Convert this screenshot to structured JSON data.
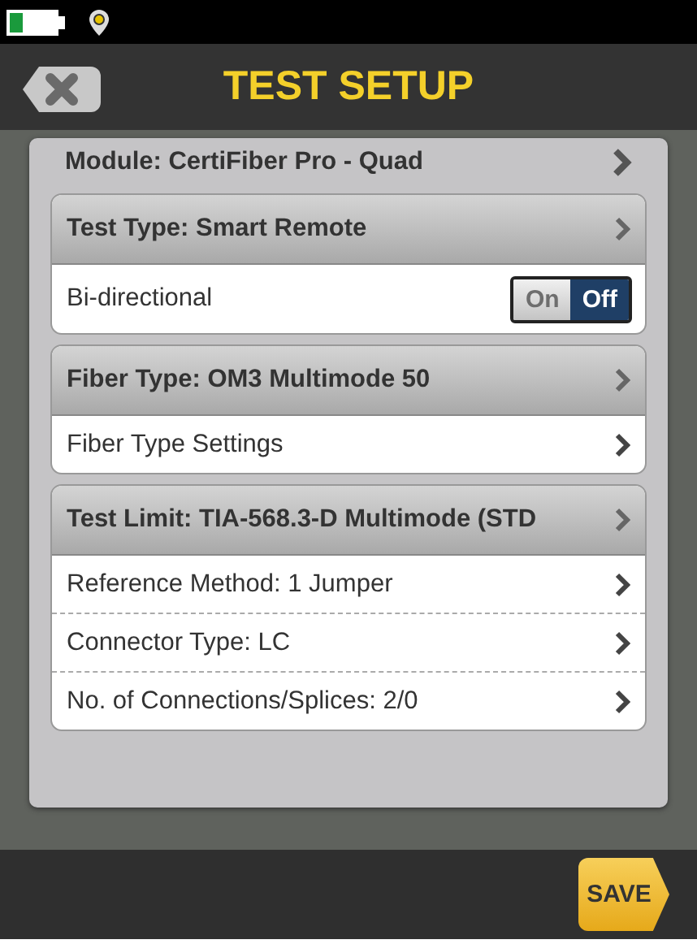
{
  "header": {
    "title": "TEST SETUP"
  },
  "module": {
    "label": "Module: CertiFiber Pro - Quad"
  },
  "groups": [
    {
      "title": "Test Type: Smart Remote",
      "rows": [
        {
          "kind": "toggle",
          "label": "Bi-directional",
          "on_label": "On",
          "off_label": "Off",
          "on": false
        }
      ]
    },
    {
      "title": "Fiber Type: OM3 Multimode 50",
      "rows": [
        {
          "kind": "link",
          "label": "Fiber Type Settings"
        }
      ]
    },
    {
      "title": "Test Limit: TIA-568.3-D Multimode (STD",
      "rows": [
        {
          "kind": "link",
          "label": "Reference Method: 1 Jumper"
        },
        {
          "kind": "link",
          "label": "Connector Type: LC"
        },
        {
          "kind": "link",
          "label": "No. of Connections/Splices: 2/0"
        }
      ]
    }
  ],
  "footer": {
    "save": "SAVE"
  }
}
